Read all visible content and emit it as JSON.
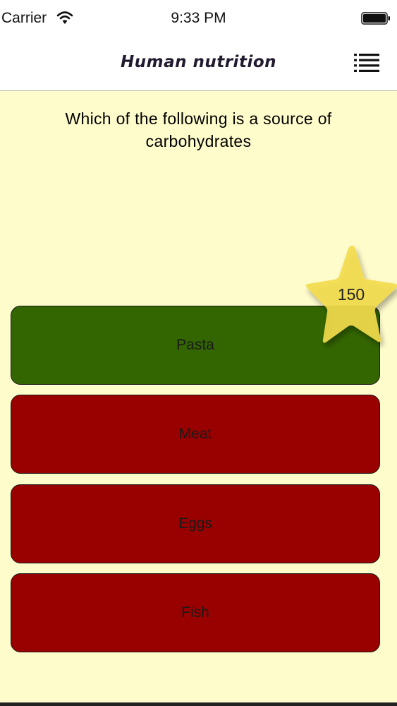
{
  "status_bar": {
    "carrier": "Carrier",
    "time": "9:33 PM",
    "wifi_icon": "wifi-icon",
    "battery_icon": "battery-icon"
  },
  "nav": {
    "title": "Human nutrition",
    "menu_icon": "list-icon"
  },
  "question": "Which of the following is a source of carbohydrates",
  "answers": [
    {
      "label": "Pasta",
      "state": "correct",
      "color": "#336600"
    },
    {
      "label": "Meat",
      "state": "wrong",
      "color": "#990000"
    },
    {
      "label": "Eggs",
      "state": "wrong",
      "color": "#990000"
    },
    {
      "label": "Fish",
      "state": "wrong",
      "color": "#990000"
    }
  ],
  "score": {
    "value": "150",
    "icon": "star-icon",
    "color": "#f3dc4e"
  },
  "colors": {
    "background": "#fffccc",
    "header": "#ffffff"
  }
}
